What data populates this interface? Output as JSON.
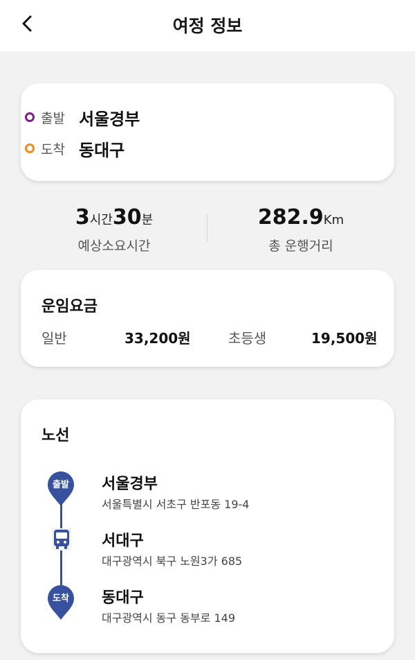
{
  "header": {
    "title": "여정 정보"
  },
  "route": {
    "departure_label": "출발",
    "departure_value": "서울경부",
    "arrival_label": "도착",
    "arrival_value": "동대구"
  },
  "stats": {
    "hours": "3",
    "hours_unit": "시간",
    "minutes": "30",
    "minutes_unit": "분",
    "duration_label": "예상소요시간",
    "distance": "282.9",
    "distance_unit": "Km",
    "distance_label": "총 운행거리"
  },
  "fare": {
    "title": "운임요금",
    "adult_label": "일반",
    "adult_value": "33,200원",
    "child_label": "초등생",
    "child_value": "19,500원"
  },
  "line": {
    "title": "노선",
    "stops": [
      {
        "badge": "출발",
        "name": "서울경부",
        "address": "서울특별시 서초구 반포동 19-4"
      },
      {
        "badge": "",
        "name": "서대구",
        "address": "대구광역시 북구 노원3가 685"
      },
      {
        "badge": "도착",
        "name": "동대구",
        "address": "대구광역시 동구 동부로 149"
      }
    ]
  },
  "colors": {
    "departure_ring": "#7a1f82",
    "arrival_ring": "#f08c1a",
    "timeline": "#37519e"
  },
  "icons": {
    "back": "chevron-left-icon",
    "bus": "bus-icon",
    "pin": "map-pin-icon"
  }
}
